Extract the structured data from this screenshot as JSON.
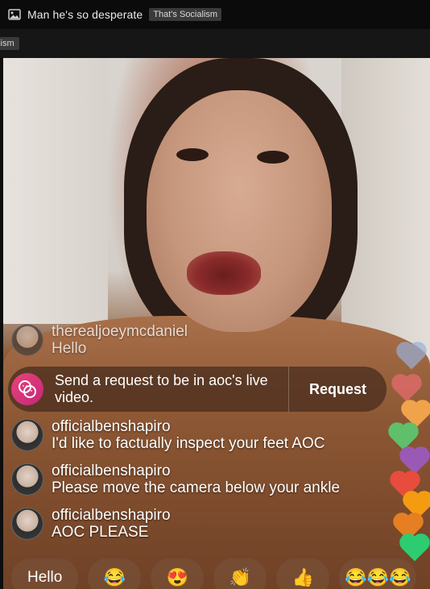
{
  "post": {
    "title": "Man he's so desperate",
    "flair": "That's Socialism",
    "flair_clipped": "cialism"
  },
  "icons": {
    "post_type": "image-icon",
    "request": "two-faces-icon"
  },
  "comments": [
    {
      "username": "therealjoeymcdaniel",
      "message": "Hello"
    },
    {
      "username": "officialbenshapiro",
      "message": "I'd like to factually inspect your feet AOC"
    },
    {
      "username": "officialbenshapiro",
      "message": "Please move the camera below your ankle"
    },
    {
      "username": "officialbenshapiro",
      "message": "AOC PLEASE"
    }
  ],
  "request_banner": {
    "text": "Send a request to be in aoc's live video.",
    "button": "Request"
  },
  "quick_replies": {
    "hello": "Hello",
    "laugh": "😂",
    "heart_eyes": "😍",
    "clap": "👏",
    "thumbs_up": "👍",
    "triple_laugh": "😂😂😂"
  },
  "colors": {
    "request_icon": "#e8437a",
    "banner_bg": "#4a2e1e",
    "header_bg": "#0b0b0b"
  }
}
